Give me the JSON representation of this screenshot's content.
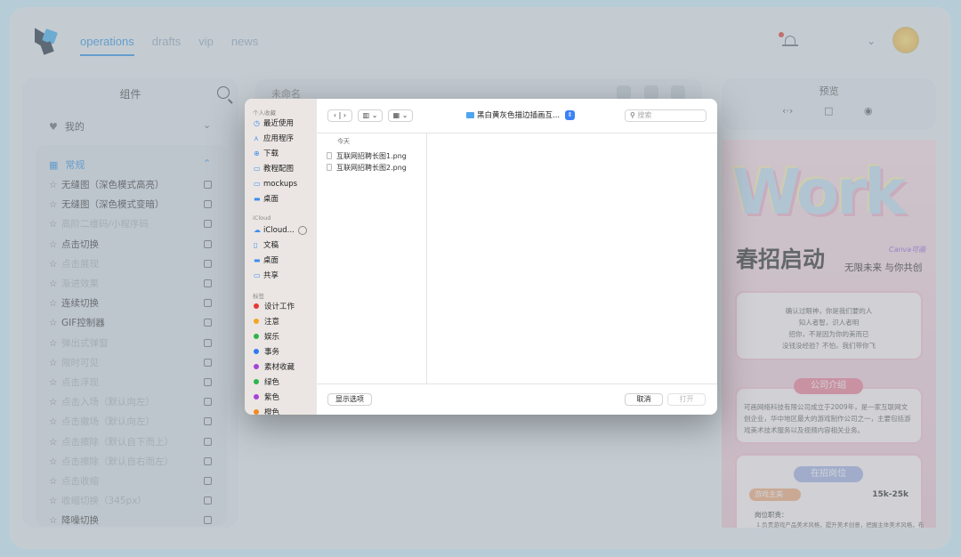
{
  "nav": {
    "tabs": [
      "operations",
      "drafts",
      "vip",
      "news"
    ]
  },
  "left_panel": {
    "title": "组件",
    "favorites_label": "我的",
    "section_label": "常规",
    "items": [
      {
        "label": "无缝图（深色模式高亮）",
        "dim": false
      },
      {
        "label": "无缝图（深色模式变暗）",
        "dim": false
      },
      {
        "label": "高阶二维码/小程序码",
        "dim": true
      },
      {
        "label": "点击切换",
        "dim": false
      },
      {
        "label": "点击展现",
        "dim": true
      },
      {
        "label": "渐进效果",
        "dim": true
      },
      {
        "label": "连续切换",
        "dim": false
      },
      {
        "label": "GIF控制器",
        "dim": false
      },
      {
        "label": "弹出式弹窗",
        "dim": true
      },
      {
        "label": "限时可见",
        "dim": true
      },
      {
        "label": "点击浮现",
        "dim": true
      },
      {
        "label": "点击入场（默认向左）",
        "dim": true
      },
      {
        "label": "点击撤场（默认向左）",
        "dim": true
      },
      {
        "label": "点击擦除（默认自下而上）",
        "dim": true
      },
      {
        "label": "点击擦除（默认自右而左）",
        "dim": true
      },
      {
        "label": "点击收缩",
        "dim": true
      },
      {
        "label": "收缩切换（345px）",
        "dim": true
      },
      {
        "label": "降噪切换",
        "dim": false
      }
    ]
  },
  "editor": {
    "doc_title": "未命名"
  },
  "preview": {
    "title": "预览",
    "poster": {
      "headline_art": "Work",
      "watermark": "Canva可画",
      "title": "春招启动",
      "subtitle": "无限未来 与你共创",
      "intro_lines": [
        "确认过眼神，你是我们要的人",
        "知人者智，识人者明",
        "招你，不是因为你的美而已",
        "没钱没经验？不怕，我们带你飞"
      ],
      "company_pill": "公司介绍",
      "company_text": "可画网络科技有限公司成立于2009年，是一家互联网文创企业，华中地区最大的游戏制作公司之一，主要包括游戏美术技术服务以及视频内容相关业务。",
      "jobs_pill": "在招岗位",
      "job_tag": "游戏主美",
      "salary": "15k-25k",
      "duty_label": "岗位职责：",
      "duty_text": "1.负责游戏产品美术风格，提升美术创意，把握主体美术风格，布"
    }
  },
  "dialog": {
    "sidebar": {
      "favorites_head": "个人收藏",
      "favorites": [
        {
          "icon": "clock-icon",
          "glyph": "◷",
          "label": "最近使用"
        },
        {
          "icon": "apps-icon",
          "glyph": "⋏",
          "label": "应用程序"
        },
        {
          "icon": "download-icon",
          "glyph": "⊕",
          "label": "下载"
        },
        {
          "icon": "folder-icon",
          "glyph": "▭",
          "label": "教程配图"
        },
        {
          "icon": "folder-icon",
          "glyph": "▭",
          "label": "mockups"
        },
        {
          "icon": "desktop-icon",
          "glyph": "▬",
          "label": "桌面"
        }
      ],
      "icloud_head": "iCloud",
      "icloud": [
        {
          "icon": "cloud-icon",
          "glyph": "☁",
          "label": "iCloud..."
        },
        {
          "icon": "document-icon",
          "glyph": "▯",
          "label": "文稿"
        },
        {
          "icon": "desktop-icon",
          "glyph": "▬",
          "label": "桌面"
        },
        {
          "icon": "shared-folder-icon",
          "glyph": "▭",
          "label": "共享"
        }
      ],
      "tags_head": "标签",
      "tags": [
        {
          "label": "设计工作",
          "color": "#e53935"
        },
        {
          "label": "注意",
          "color": "#f5a623"
        },
        {
          "label": "娱乐",
          "color": "#2bb64a"
        },
        {
          "label": "事务",
          "color": "#2f7bf5"
        },
        {
          "label": "素材收藏",
          "color": "#a543d8"
        },
        {
          "label": "绿色",
          "color": "#2bb64a"
        },
        {
          "label": "紫色",
          "color": "#a543d8"
        },
        {
          "label": "橙色",
          "color": "#f08a24"
        }
      ]
    },
    "location": "黑白黄灰色描边插画互...",
    "search_placeholder": "搜索",
    "column_header": "今天",
    "files": [
      "互联网招聘长图1.png",
      "互联网招聘长图2.png"
    ],
    "options_button": "显示选项",
    "cancel_button": "取消",
    "open_button": "打开"
  }
}
